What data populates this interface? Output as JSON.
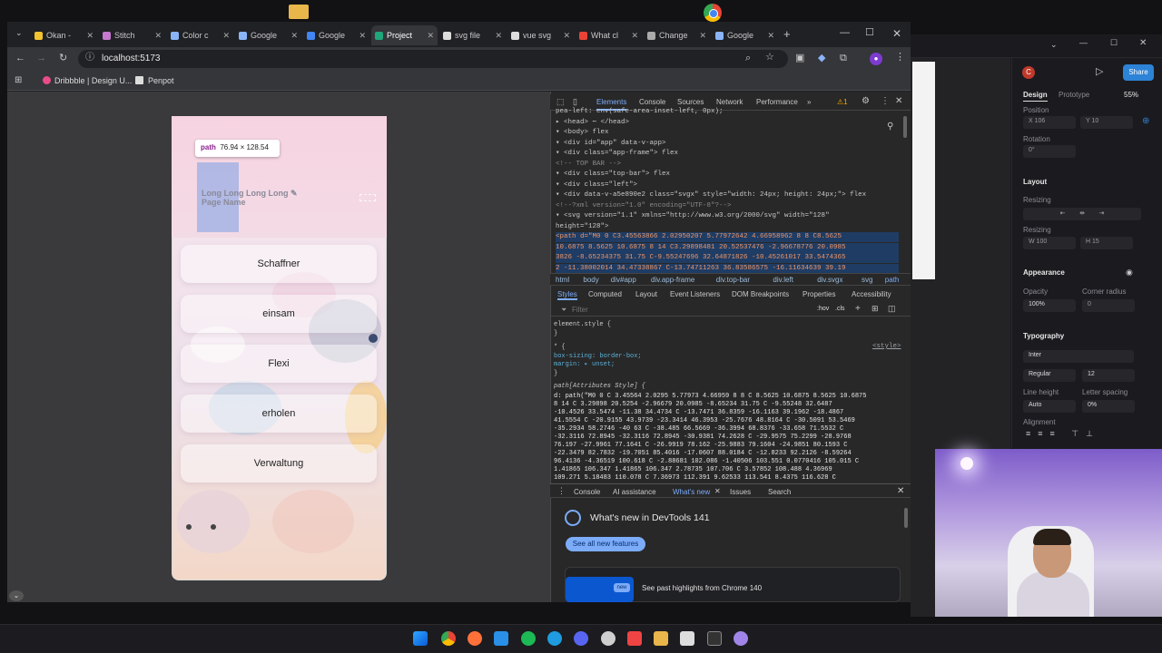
{
  "browser": {
    "tabs": [
      {
        "title": "Okan -",
        "color": "#f4c430"
      },
      {
        "title": "Stitch",
        "color": "#c779d0"
      },
      {
        "title": "Color c",
        "color": "#8ab4f8"
      },
      {
        "title": "Google",
        "color": "#8ab4f8"
      },
      {
        "title": "Google",
        "color": "#4285f4"
      },
      {
        "title": "Project",
        "color": "#1fa67a"
      },
      {
        "title": "svg file",
        "color": "#dddddd"
      },
      {
        "title": "vue svg",
        "color": "#dddddd"
      },
      {
        "title": "What cl",
        "color": "#ea4335"
      },
      {
        "title": "Change",
        "color": "#aaaaaa"
      },
      {
        "title": "Google",
        "color": "#8ab4f8"
      }
    ],
    "url": "localhost:5173",
    "bookmarks": [
      "Dribbble | Design U...",
      "Penpot"
    ]
  },
  "page": {
    "tooltip_tag": "path",
    "tooltip_size": "76.94 × 128.54",
    "page_name": "Long Long Long Long ✎ Page Name",
    "cards": [
      "Schaffner",
      "einsam",
      "Flexi",
      "erholen",
      "Verwaltung"
    ]
  },
  "devtools": {
    "tabs": [
      "Elements",
      "Console",
      "Sources",
      "Network",
      "Performance",
      "»"
    ],
    "warning_count": "1",
    "dom_lines": [
      "  pea-left: env(safe-area-inset-left, 0px);",
      "▸ <head> ⋯ </head>",
      "▾ <body> flex",
      "  ▾ <div id=\"app\" data-v-app>",
      "    ▾ <div class=\"app-frame\"> flex",
      "        <!-- TOP BAR -->",
      "      ▾ <div class=\"top-bar\"> flex",
      "        ▾ <div class=\"left\">",
      "          ▾ <div data-v-a5e890e2 class=\"svgx\" style=\"width: 24px; height: 24px;\"> flex",
      "              <!--?xml version=\"1.0\" encoding=\"UTF-8\"?-->",
      "            ▾ <svg version=\"1.1\" xmlns=\"http://www.w3.org/2000/svg\" width=\"128\"",
      "                height=\"128\">",
      "                <path d=\"M0 0 C3.45563866 2.02950207 5.77972642 4.66958962 8 8 C8.5625",
      "                10.6875 8.5625 10.6875 8 14 C3.29898481 20.52537476 -2.96678776 20.0985",
      "                3826 -8.65234375 31.75 C-9.55247696 32.64871826 -10.45261017 33.5474365",
      "                2 -11.38002014 34.47338867 C-13.74711263 36.83586575 -16.11634639 39.19"
    ],
    "breadcrumbs": [
      "html",
      "body",
      "div#app",
      "div.app-frame",
      "div.top-bar",
      "div.left",
      "div.svgx",
      "svg",
      "path"
    ],
    "style_tabs": [
      "Styles",
      "Computed",
      "Layout",
      "Event Listeners",
      "DOM Breakpoints",
      "Properties",
      "Accessibility"
    ],
    "filter_placeholder": "Filter",
    "filter_hov": ":hov",
    "filter_cls": ".cls",
    "styles_lines": [
      "element.style {",
      "}",
      "* {",
      "  box-sizing: border-box;",
      "  margin: ▸ unset;",
      "}",
      "path[Attributes Style] {",
      "  d: path(\"M0 0 C 3.45564 2.0295 5.77973 4.66959 8 8 C 8.5625 10.6875 8.5625 10.6875",
      "    8 14 C 3.29898 20.5254 -2.96679 20.0985 -8.65234 31.75 C -9.55248 32.6487",
      "    -10.4526 33.5474 -11.38 34.4734 C -13.7471 36.8359 -16.1163 39.1962 -18.4867",
      "    41.5554 C -20.9155 43.9739 -23.3414 46.3953 -25.7676 48.8164 C -30.5091 53.5469",
      "    -35.2934 58.2746 -40 63 C -38.485 66.5669 -36.3994 68.8376 -33.658 71.5532 C",
      "    -32.3116 72.8945 -32.3116 72.8945 -30.9381 74.2628 C -29.9575 75.2299 -28.9768",
      "    76.197 -27.9961 77.1641 C -26.9919 78.162 -25.9883 79.1604 -24.9851 80.1593 C",
      "    -22.3479 82.7832 -19.7051 85.4016 -17.0607 88.0184 C -12.8233 92.2126 -8.59264",
      "    96.4136 -4.36519 100.618 C -2.88681 102.086 -1.40506 103.551 0.0770416 105.015 C",
      "    1.41865 106.347 1.41865 106.347 2.78735 107.706 C 3.57852 108.488 4.36969",
      "    109.271 5.18483 110.078 C 7.36973 112.391 9.62533 113.541 8.4375 116.628 C"
    ],
    "style_source": "<style>",
    "drawer_tabs": [
      "Console",
      "AI assistance",
      "What's new",
      "Issues",
      "Search"
    ],
    "whats_new_title": "What's new in DevTools 141",
    "whats_new_button": "See all new features",
    "new_badge": "new",
    "past_highlights": "See past highlights from Chrome 140"
  },
  "design_panel": {
    "share": "Share",
    "tabs": [
      "Design",
      "Prototype"
    ],
    "zoom": "55%",
    "avatar": "C",
    "position_label": "Position",
    "x": "X  106",
    "y": "Y  10",
    "rotation_label": "Rotation",
    "rotation": "0°",
    "layout_label": "Layout",
    "resizing_label": "Resizing",
    "resizing_label2": "Resizing",
    "w": "W  100",
    "h": "H  15",
    "appearance_label": "Appearance",
    "opacity_label": "Opacity",
    "opacity": "100%",
    "corner_label": "Corner radius",
    "corner": "0",
    "typography_label": "Typography",
    "font": "Inter",
    "weight": "Regular",
    "size": "12",
    "line_height_label": "Line height",
    "line_height": "Auto",
    "letter_spacing_label": "Letter spacing",
    "letter_spacing": "0%",
    "alignment_label": "Alignment"
  }
}
